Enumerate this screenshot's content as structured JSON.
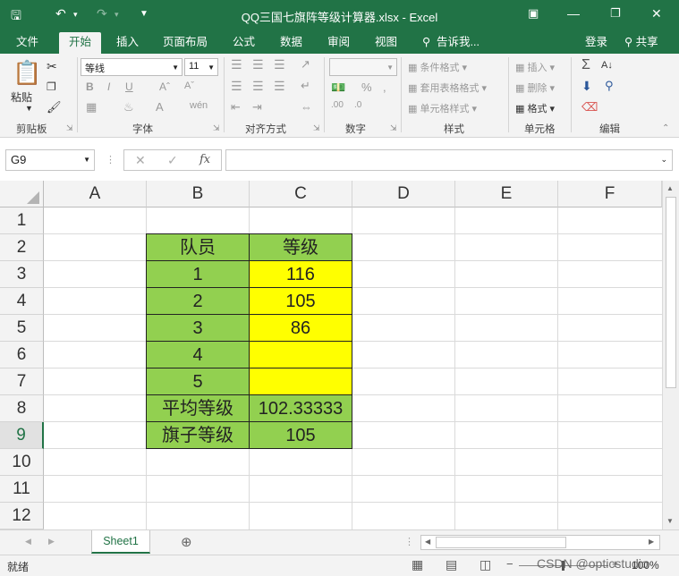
{
  "titlebar": {
    "title": "QQ三国七旗阵等级计算器.xlsx - Excel",
    "save_icon": "save-icon",
    "undo_icon": "undo-icon",
    "redo_icon": "redo-icon"
  },
  "tabs": [
    "文件",
    "开始",
    "插入",
    "页面布局",
    "公式",
    "数据",
    "审阅",
    "视图"
  ],
  "tell_me": "告诉我...",
  "login": "登录",
  "share": "共享",
  "ribbon": {
    "clipboard": {
      "paste": "粘贴",
      "label": "剪贴板"
    },
    "font": {
      "name": "等线",
      "size": "11",
      "label": "字体"
    },
    "align": {
      "label": "对齐方式"
    },
    "number": {
      "label": "数字"
    },
    "styles": {
      "cond": "条件格式",
      "table": "套用表格格式",
      "cell": "单元格样式",
      "label": "样式"
    },
    "cells": {
      "insert": "插入",
      "delete": "删除",
      "format": "格式",
      "label": "单元格"
    },
    "edit": {
      "label": "编辑"
    }
  },
  "formula_bar": {
    "name_box": "G9",
    "fx": "fx",
    "formula": ""
  },
  "columns": [
    "A",
    "B",
    "C",
    "D",
    "E",
    "F"
  ],
  "rows": [
    "1",
    "2",
    "3",
    "4",
    "5",
    "6",
    "7",
    "8",
    "9",
    "10",
    "11",
    "12"
  ],
  "selected_row": "9",
  "table": {
    "header": [
      "队员",
      "等级"
    ],
    "body": [
      [
        "1",
        "116"
      ],
      [
        "2",
        "105"
      ],
      [
        "3",
        "86"
      ],
      [
        "4",
        ""
      ],
      [
        "5",
        ""
      ],
      [
        "平均等级",
        "102.33333"
      ],
      [
        "旗子等级",
        "105"
      ]
    ]
  },
  "sheet_tabs": [
    "Sheet1"
  ],
  "status": {
    "ready": "就绪",
    "zoom": "100%"
  },
  "watermark": "CSDN @opticstudio",
  "colors": {
    "accent": "#217346",
    "green_fill": "#92d050",
    "yellow_fill": "#ffff00"
  }
}
